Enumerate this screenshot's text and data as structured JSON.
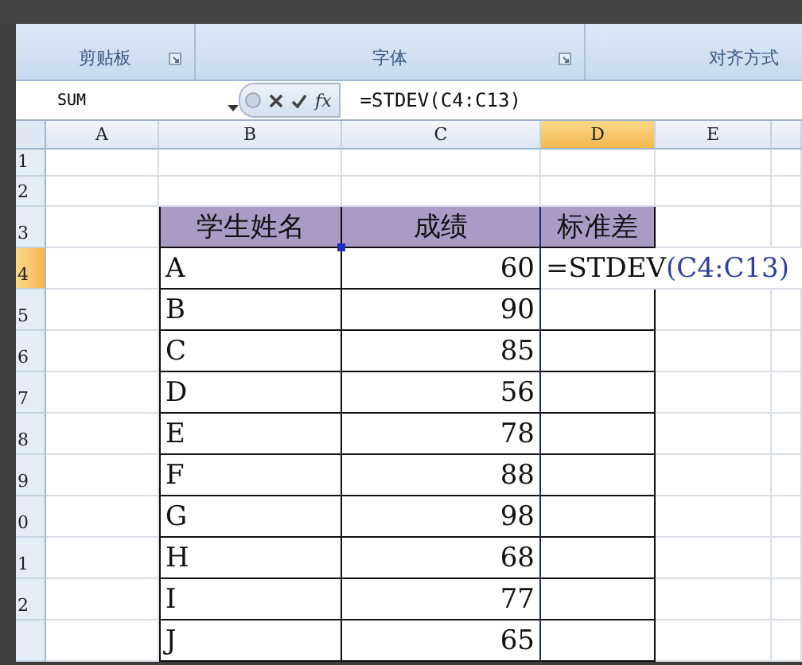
{
  "ribbon": {
    "groups": [
      {
        "label": "剪贴板",
        "launcher": true
      },
      {
        "label": "字体",
        "launcher": true
      },
      {
        "label": "对齐方式"
      }
    ]
  },
  "formula_bar": {
    "name_box": "SUM",
    "fx": "fx",
    "formula": "=STDEV(C4:C13)"
  },
  "columns": [
    {
      "label": "A",
      "selected": false
    },
    {
      "label": "B",
      "selected": false
    },
    {
      "label": "C",
      "selected": false
    },
    {
      "label": "D",
      "selected": true
    },
    {
      "label": "E",
      "selected": false
    }
  ],
  "rows": [
    {
      "number": "1",
      "selected": false,
      "cells": []
    },
    {
      "number": "2",
      "selected": false,
      "cells": []
    },
    {
      "number": "3",
      "selected": false,
      "cells": [
        {
          "kind": "header",
          "text": "学生姓名"
        },
        {
          "kind": "header",
          "text": "成绩"
        },
        {
          "kind": "header",
          "text": "标准差"
        }
      ]
    },
    {
      "number": "4",
      "selected": true,
      "cells": [
        {
          "kind": "name",
          "text": "A"
        },
        {
          "kind": "score",
          "text": "60"
        },
        {
          "kind": "editing",
          "text": "=STDEV",
          "ref": "(C4:C13)"
        }
      ]
    },
    {
      "number": "5",
      "selected": false,
      "cells": [
        {
          "kind": "name",
          "text": "B"
        },
        {
          "kind": "score",
          "text": "90"
        },
        {
          "kind": "empty"
        }
      ]
    },
    {
      "number": "6",
      "selected": false,
      "cells": [
        {
          "kind": "name",
          "text": "C"
        },
        {
          "kind": "score",
          "text": "85"
        },
        {
          "kind": "empty"
        }
      ]
    },
    {
      "number": "7",
      "selected": false,
      "cells": [
        {
          "kind": "name",
          "text": "D"
        },
        {
          "kind": "score",
          "text": "56"
        },
        {
          "kind": "empty"
        }
      ]
    },
    {
      "number": "8",
      "selected": false,
      "cells": [
        {
          "kind": "name",
          "text": "E"
        },
        {
          "kind": "score",
          "text": "78"
        },
        {
          "kind": "empty"
        }
      ]
    },
    {
      "number": "9",
      "selected": false,
      "cells": [
        {
          "kind": "name",
          "text": "F"
        },
        {
          "kind": "score",
          "text": "88"
        },
        {
          "kind": "empty"
        }
      ]
    },
    {
      "number": "0",
      "selected": false,
      "cells": [
        {
          "kind": "name",
          "text": "G"
        },
        {
          "kind": "score",
          "text": "98"
        },
        {
          "kind": "empty"
        }
      ]
    },
    {
      "number": "1",
      "selected": false,
      "cells": [
        {
          "kind": "name",
          "text": "H"
        },
        {
          "kind": "score",
          "text": "68"
        },
        {
          "kind": "empty"
        }
      ]
    },
    {
      "number": "2",
      "selected": false,
      "cells": [
        {
          "kind": "name",
          "text": "I"
        },
        {
          "kind": "score",
          "text": "77"
        },
        {
          "kind": "empty"
        }
      ]
    },
    {
      "number": "",
      "selected": false,
      "cells": [
        {
          "kind": "name",
          "text": "J"
        },
        {
          "kind": "score",
          "text": "65"
        },
        {
          "kind": "empty"
        }
      ]
    }
  ]
}
